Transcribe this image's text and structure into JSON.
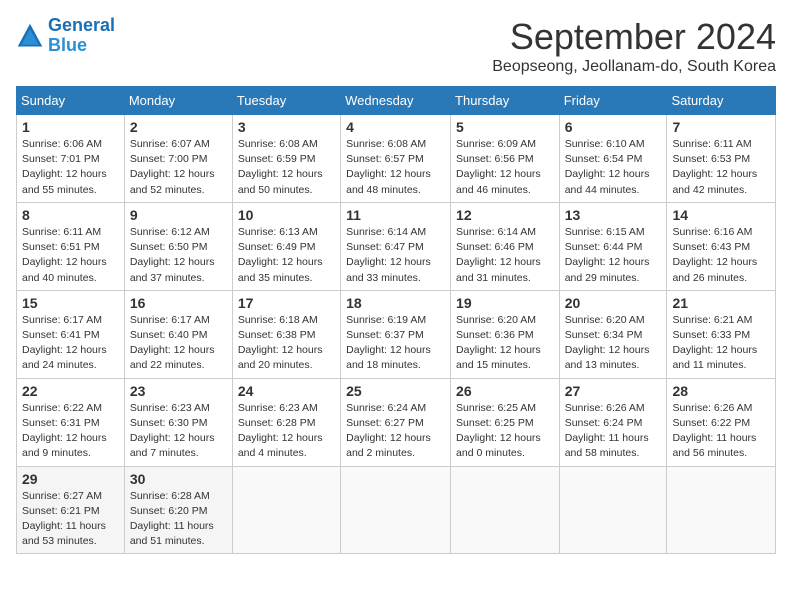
{
  "header": {
    "logo_line1": "General",
    "logo_line2": "Blue",
    "month_title": "September 2024",
    "subtitle": "Beopseong, Jeollanam-do, South Korea"
  },
  "weekdays": [
    "Sunday",
    "Monday",
    "Tuesday",
    "Wednesday",
    "Thursday",
    "Friday",
    "Saturday"
  ],
  "weeks": [
    [
      {
        "day": "1",
        "lines": [
          "Sunrise: 6:06 AM",
          "Sunset: 7:01 PM",
          "Daylight: 12 hours",
          "and 55 minutes."
        ]
      },
      {
        "day": "2",
        "lines": [
          "Sunrise: 6:07 AM",
          "Sunset: 7:00 PM",
          "Daylight: 12 hours",
          "and 52 minutes."
        ]
      },
      {
        "day": "3",
        "lines": [
          "Sunrise: 6:08 AM",
          "Sunset: 6:59 PM",
          "Daylight: 12 hours",
          "and 50 minutes."
        ]
      },
      {
        "day": "4",
        "lines": [
          "Sunrise: 6:08 AM",
          "Sunset: 6:57 PM",
          "Daylight: 12 hours",
          "and 48 minutes."
        ]
      },
      {
        "day": "5",
        "lines": [
          "Sunrise: 6:09 AM",
          "Sunset: 6:56 PM",
          "Daylight: 12 hours",
          "and 46 minutes."
        ]
      },
      {
        "day": "6",
        "lines": [
          "Sunrise: 6:10 AM",
          "Sunset: 6:54 PM",
          "Daylight: 12 hours",
          "and 44 minutes."
        ]
      },
      {
        "day": "7",
        "lines": [
          "Sunrise: 6:11 AM",
          "Sunset: 6:53 PM",
          "Daylight: 12 hours",
          "and 42 minutes."
        ]
      }
    ],
    [
      {
        "day": "8",
        "lines": [
          "Sunrise: 6:11 AM",
          "Sunset: 6:51 PM",
          "Daylight: 12 hours",
          "and 40 minutes."
        ]
      },
      {
        "day": "9",
        "lines": [
          "Sunrise: 6:12 AM",
          "Sunset: 6:50 PM",
          "Daylight: 12 hours",
          "and 37 minutes."
        ]
      },
      {
        "day": "10",
        "lines": [
          "Sunrise: 6:13 AM",
          "Sunset: 6:49 PM",
          "Daylight: 12 hours",
          "and 35 minutes."
        ]
      },
      {
        "day": "11",
        "lines": [
          "Sunrise: 6:14 AM",
          "Sunset: 6:47 PM",
          "Daylight: 12 hours",
          "and 33 minutes."
        ]
      },
      {
        "day": "12",
        "lines": [
          "Sunrise: 6:14 AM",
          "Sunset: 6:46 PM",
          "Daylight: 12 hours",
          "and 31 minutes."
        ]
      },
      {
        "day": "13",
        "lines": [
          "Sunrise: 6:15 AM",
          "Sunset: 6:44 PM",
          "Daylight: 12 hours",
          "and 29 minutes."
        ]
      },
      {
        "day": "14",
        "lines": [
          "Sunrise: 6:16 AM",
          "Sunset: 6:43 PM",
          "Daylight: 12 hours",
          "and 26 minutes."
        ]
      }
    ],
    [
      {
        "day": "15",
        "lines": [
          "Sunrise: 6:17 AM",
          "Sunset: 6:41 PM",
          "Daylight: 12 hours",
          "and 24 minutes."
        ]
      },
      {
        "day": "16",
        "lines": [
          "Sunrise: 6:17 AM",
          "Sunset: 6:40 PM",
          "Daylight: 12 hours",
          "and 22 minutes."
        ]
      },
      {
        "day": "17",
        "lines": [
          "Sunrise: 6:18 AM",
          "Sunset: 6:38 PM",
          "Daylight: 12 hours",
          "and 20 minutes."
        ]
      },
      {
        "day": "18",
        "lines": [
          "Sunrise: 6:19 AM",
          "Sunset: 6:37 PM",
          "Daylight: 12 hours",
          "and 18 minutes."
        ]
      },
      {
        "day": "19",
        "lines": [
          "Sunrise: 6:20 AM",
          "Sunset: 6:36 PM",
          "Daylight: 12 hours",
          "and 15 minutes."
        ]
      },
      {
        "day": "20",
        "lines": [
          "Sunrise: 6:20 AM",
          "Sunset: 6:34 PM",
          "Daylight: 12 hours",
          "and 13 minutes."
        ]
      },
      {
        "day": "21",
        "lines": [
          "Sunrise: 6:21 AM",
          "Sunset: 6:33 PM",
          "Daylight: 12 hours",
          "and 11 minutes."
        ]
      }
    ],
    [
      {
        "day": "22",
        "lines": [
          "Sunrise: 6:22 AM",
          "Sunset: 6:31 PM",
          "Daylight: 12 hours",
          "and 9 minutes."
        ]
      },
      {
        "day": "23",
        "lines": [
          "Sunrise: 6:23 AM",
          "Sunset: 6:30 PM",
          "Daylight: 12 hours",
          "and 7 minutes."
        ]
      },
      {
        "day": "24",
        "lines": [
          "Sunrise: 6:23 AM",
          "Sunset: 6:28 PM",
          "Daylight: 12 hours",
          "and 4 minutes."
        ]
      },
      {
        "day": "25",
        "lines": [
          "Sunrise: 6:24 AM",
          "Sunset: 6:27 PM",
          "Daylight: 12 hours",
          "and 2 minutes."
        ]
      },
      {
        "day": "26",
        "lines": [
          "Sunrise: 6:25 AM",
          "Sunset: 6:25 PM",
          "Daylight: 12 hours",
          "and 0 minutes."
        ]
      },
      {
        "day": "27",
        "lines": [
          "Sunrise: 6:26 AM",
          "Sunset: 6:24 PM",
          "Daylight: 11 hours",
          "and 58 minutes."
        ]
      },
      {
        "day": "28",
        "lines": [
          "Sunrise: 6:26 AM",
          "Sunset: 6:22 PM",
          "Daylight: 11 hours",
          "and 56 minutes."
        ]
      }
    ],
    [
      {
        "day": "29",
        "lines": [
          "Sunrise: 6:27 AM",
          "Sunset: 6:21 PM",
          "Daylight: 11 hours",
          "and 53 minutes."
        ]
      },
      {
        "day": "30",
        "lines": [
          "Sunrise: 6:28 AM",
          "Sunset: 6:20 PM",
          "Daylight: 11 hours",
          "and 51 minutes."
        ]
      },
      {
        "day": "",
        "lines": []
      },
      {
        "day": "",
        "lines": []
      },
      {
        "day": "",
        "lines": []
      },
      {
        "day": "",
        "lines": []
      },
      {
        "day": "",
        "lines": []
      }
    ]
  ]
}
